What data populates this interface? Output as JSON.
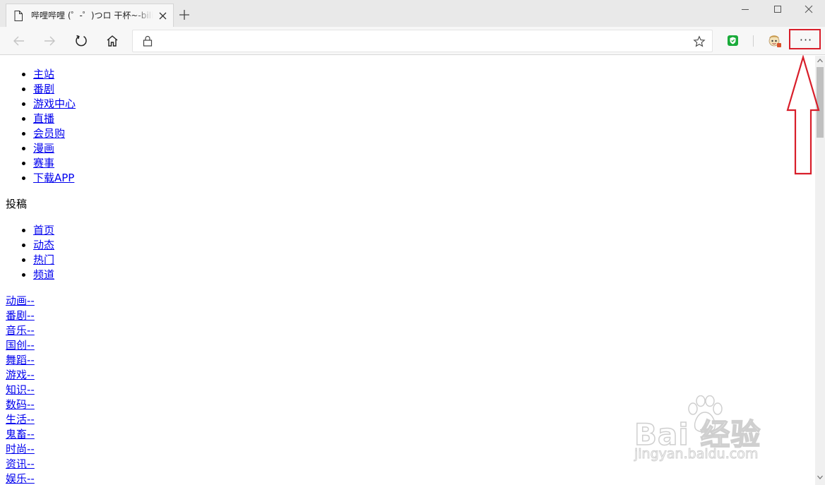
{
  "browser": {
    "tab_title": "哔哩哔哩 (゜-゜)つロ 干杯~-bilibili",
    "address_value": "",
    "icons": {
      "page": "page-icon",
      "tab_close": "close-icon",
      "new_tab": "plus-icon",
      "back": "arrow-left-icon",
      "forward": "arrow-right-icon",
      "reload": "reload-icon",
      "home": "home-icon",
      "lock": "lock-icon",
      "favorite": "star-icon",
      "extension_1": "shield-check-icon",
      "extension_2": "avatar-icon",
      "more": "more-horizontal-icon"
    },
    "more_label": "···",
    "accent_colors": {
      "highlight": "#d81e2a",
      "extension_green": "#1aab3a",
      "link": "#0000ee"
    }
  },
  "page": {
    "top_nav": [
      "主站",
      "番剧",
      "游戏中心",
      "直播",
      "会员购",
      "漫画",
      "赛事",
      "下载APP"
    ],
    "contribute_label": "投稿",
    "sub_nav": [
      "首页",
      "动态",
      "热门",
      "频道"
    ],
    "categories": [
      "动画",
      "番剧",
      "音乐",
      "国创",
      "舞蹈",
      "游戏",
      "知识",
      "数码",
      "生活",
      "鬼畜",
      "时尚",
      "资讯",
      "娱乐"
    ],
    "category_separator": "--"
  },
  "watermark": {
    "main": "Bai  经验",
    "sub": "jingyan.baidu.com"
  }
}
